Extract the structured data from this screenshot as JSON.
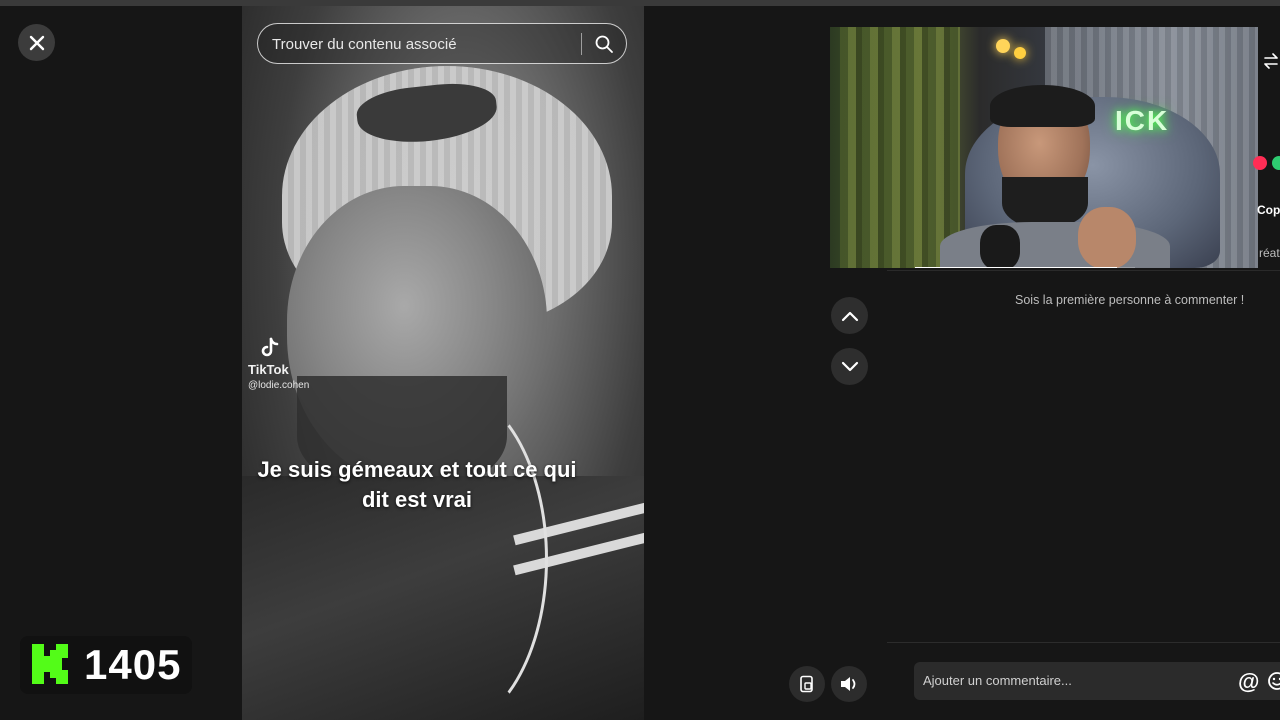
{
  "video": {
    "search_placeholder": "Trouver du contenu associé",
    "caption_line1": "Je suis gémeaux et tout ce qui",
    "caption_line2": "dit est vrai",
    "watermark_app": "TikTok",
    "watermark_user": "@lodie.cohen"
  },
  "kick_badge": {
    "count": "1405",
    "brand_color": "#53fc18"
  },
  "webcam": {
    "sign_text": "ICK",
    "progress_fraction": 0.92
  },
  "side_panel": {
    "empty_comments_text": "Sois la première personne à commenter !",
    "partial_label_1": "Cop",
    "partial_label_2": "réat",
    "comment_placeholder": "Ajouter un commentaire...",
    "mention_symbol": "@"
  },
  "icons": {
    "close": "close-icon",
    "search": "search-icon",
    "arrow_up": "chevron-up-icon",
    "arrow_down": "chevron-down-icon",
    "mobile": "phone-icon",
    "volume": "volume-icon",
    "emoji": "emoji-icon",
    "swap": "swap-icon"
  }
}
